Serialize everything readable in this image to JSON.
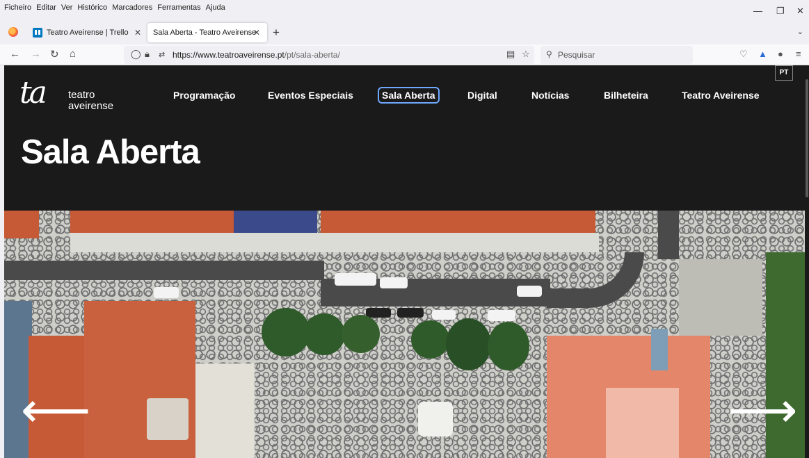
{
  "menubar": {
    "items": [
      "Ficheiro",
      "Editar",
      "Ver",
      "Histórico",
      "Marcadores",
      "Ferramentas",
      "Ajuda"
    ],
    "minimize_icon": "minimize-icon",
    "restore_icon": "restore-icon",
    "close_icon": "close-icon"
  },
  "tabs": [
    {
      "title": "Teatro Aveirense | Trello",
      "active": false,
      "icon": "trello-icon"
    },
    {
      "title": "Sala Aberta - Teatro Aveirense",
      "active": true
    }
  ],
  "navbar": {
    "url_domain": "https://www.teatroaveirense.pt",
    "url_path": "/pt/sala-aberta/",
    "search_placeholder": "Pesquisar"
  },
  "site": {
    "logo_mark": "ta",
    "logo_line1": "teatro",
    "logo_line2": "aveirense",
    "lang": "PT",
    "nav": [
      "Programação",
      "Eventos Especiais",
      "Sala Aberta",
      "Digital",
      "Notícias",
      "Bilheteira",
      "Teatro Aveirense"
    ],
    "selected_nav": "Sala Aberta",
    "page_title": "Sala Aberta"
  },
  "colors": {
    "page_bg": "#1a1a1a",
    "roof": "#c75a36",
    "road": "#4a4a4a",
    "tree": "#2f5a2a",
    "focus_outline": "#6ea8ff"
  }
}
